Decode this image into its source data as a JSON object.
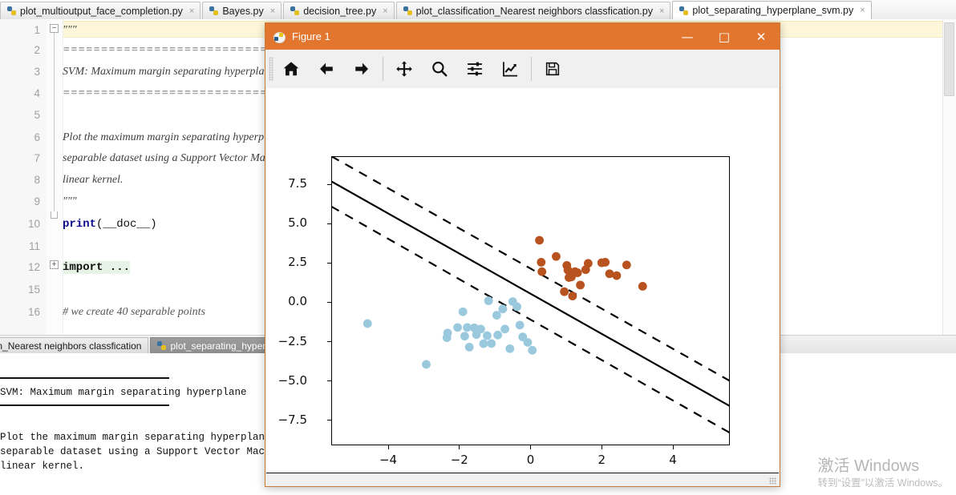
{
  "editor": {
    "tabs": [
      {
        "label": "plot_multioutput_face_completion.py",
        "active": false
      },
      {
        "label": "Bayes.py",
        "active": false
      },
      {
        "label": "decision_tree.py",
        "active": false
      },
      {
        "label": "plot_classification_Nearest neighbors classfication.py",
        "active": false
      },
      {
        "label": "plot_separating_hyperplane_svm.py",
        "active": true
      }
    ],
    "close_glyph": "×",
    "line_numbers": [
      "1",
      "2",
      "3",
      "4",
      "5",
      "6",
      "7",
      "8",
      "9",
      "10",
      "11",
      "12",
      "15",
      "16"
    ],
    "lines": [
      {
        "n": "1",
        "text": "\"\"\"",
        "kind": "doc"
      },
      {
        "n": "2",
        "text": "=========================================",
        "kind": "doc"
      },
      {
        "n": "3",
        "text": "SVM: Maximum margin separating hyperplane",
        "kind": "doc"
      },
      {
        "n": "4",
        "text": "=========================================",
        "kind": "doc"
      },
      {
        "n": "5",
        "text": "",
        "kind": "doc"
      },
      {
        "n": "6",
        "text": "Plot the maximum margin separating hyperplane within a two-class",
        "kind": "doc"
      },
      {
        "n": "7",
        "text": "separable dataset using a Support Vector Machine classifier with",
        "kind": "doc"
      },
      {
        "n": "8",
        "text": "linear kernel.",
        "kind": "doc"
      },
      {
        "n": "9",
        "text": "\"\"\"",
        "kind": "doc"
      },
      {
        "n": "10",
        "text": "print(__doc__)",
        "kind": "code"
      },
      {
        "n": "11",
        "text": "",
        "kind": "code"
      },
      {
        "n": "12",
        "text": "import ...",
        "kind": "import"
      },
      {
        "n": "15",
        "text": "",
        "kind": "code"
      },
      {
        "n": "16",
        "text": "# we create 40 separable points",
        "kind": "comment"
      }
    ],
    "code_keyword": "print",
    "code_arg": "(__doc__)",
    "import_text": "import ..."
  },
  "console": {
    "tabs": [
      {
        "label": "plot_classification_Nearest neighbors classfication",
        "active": false
      },
      {
        "label": "plot_separating_hyperplane_svm",
        "active": true
      }
    ],
    "output": [
      "=========================================",
      "SVM: Maximum margin separating hyperplane",
      "=========================================",
      "Plot the maximum margin separating hyperplane within a two-class",
      "separable dataset using a Support Vector Machine classifier with",
      "linear kernel."
    ]
  },
  "figure": {
    "title": "Figure 1",
    "window_buttons": {
      "minimize": "—",
      "maximize": "□",
      "close": "✕"
    },
    "toolbar": [
      {
        "name": "home-icon",
        "tip": "Home"
      },
      {
        "name": "back-arrow-icon",
        "tip": "Back"
      },
      {
        "name": "forward-arrow-icon",
        "tip": "Forward"
      },
      {
        "name": "pan-move-icon",
        "tip": "Pan"
      },
      {
        "name": "zoom-magnifier-icon",
        "tip": "Zoom to rectangle"
      },
      {
        "name": "configure-subplots-icon",
        "tip": "Configure subplots"
      },
      {
        "name": "edit-axis-curve-icon",
        "tip": "Edit axis, curve and image parameters"
      },
      {
        "name": "save-floppy-icon",
        "tip": "Save the figure"
      }
    ]
  },
  "colors": {
    "title_bar": "#e2762e",
    "class_a": "#9ac9de",
    "class_b": "#b8521f",
    "hyperplane": "#000000",
    "margin": "#000000"
  },
  "watermark": {
    "line1": "激活 Windows",
    "line2": "转到“设置”以激活 Windows。"
  },
  "chart_data": {
    "type": "scatter",
    "title": "",
    "xlabel": "",
    "ylabel": "",
    "xlim": [
      -5.6,
      5.6
    ],
    "ylim": [
      -9.1,
      9.3
    ],
    "xticks": [
      -4,
      -2,
      0,
      2,
      4
    ],
    "yticks": [
      -7.5,
      -5.0,
      -2.5,
      0.0,
      2.5,
      5.0,
      7.5
    ],
    "grid": false,
    "legend": null,
    "series": [
      {
        "name": "class 0",
        "color": "#9ac9de",
        "points": [
          [
            -4.58,
            -1.35
          ],
          [
            -2.93,
            -3.95
          ],
          [
            -2.35,
            -2.25
          ],
          [
            -2.33,
            -1.95
          ],
          [
            -2.05,
            -1.6
          ],
          [
            -1.9,
            -0.6
          ],
          [
            -1.85,
            -2.15
          ],
          [
            -1.78,
            -1.6
          ],
          [
            -1.72,
            -2.85
          ],
          [
            -1.58,
            -1.62
          ],
          [
            -1.52,
            -2.05
          ],
          [
            -1.4,
            -1.7
          ],
          [
            -1.32,
            -2.63
          ],
          [
            -1.22,
            -2.12
          ],
          [
            -1.18,
            0.1
          ],
          [
            -1.1,
            -2.62
          ],
          [
            -0.95,
            -0.82
          ],
          [
            -0.92,
            -2.08
          ],
          [
            -0.78,
            -0.42
          ],
          [
            -0.72,
            -1.7
          ],
          [
            -0.58,
            -2.95
          ],
          [
            -0.5,
            0.05
          ],
          [
            -0.38,
            -0.28
          ],
          [
            -0.3,
            -1.45
          ],
          [
            -0.22,
            -2.2
          ],
          [
            -0.08,
            -2.55
          ],
          [
            0.05,
            -3.05
          ]
        ]
      },
      {
        "name": "class 1",
        "color": "#b8521f",
        "points": [
          [
            0.25,
            3.95
          ],
          [
            0.3,
            2.55
          ],
          [
            0.32,
            1.95
          ],
          [
            0.72,
            2.92
          ],
          [
            0.95,
            0.68
          ],
          [
            1.02,
            2.35
          ],
          [
            1.05,
            2.05
          ],
          [
            1.08,
            1.58
          ],
          [
            1.15,
            1.62
          ],
          [
            1.18,
            0.4
          ],
          [
            1.25,
            1.95
          ],
          [
            1.32,
            1.88
          ],
          [
            1.4,
            1.1
          ],
          [
            1.55,
            2.08
          ],
          [
            1.62,
            2.48
          ],
          [
            2.0,
            2.52
          ],
          [
            2.1,
            2.55
          ],
          [
            2.22,
            1.82
          ],
          [
            2.42,
            1.7
          ],
          [
            2.7,
            2.38
          ],
          [
            3.15,
            1.02
          ]
        ]
      }
    ],
    "lines": [
      {
        "name": "decision boundary",
        "style": "solid",
        "from": [
          -5.6,
          7.7
        ],
        "to": [
          5.6,
          -6.6
        ]
      },
      {
        "name": "margin upper",
        "style": "dashed",
        "from": [
          -5.6,
          9.3
        ],
        "to": [
          5.6,
          -5.0
        ]
      },
      {
        "name": "margin lower",
        "style": "dashed",
        "from": [
          -5.6,
          6.1
        ],
        "to": [
          5.6,
          -8.3
        ]
      }
    ]
  }
}
